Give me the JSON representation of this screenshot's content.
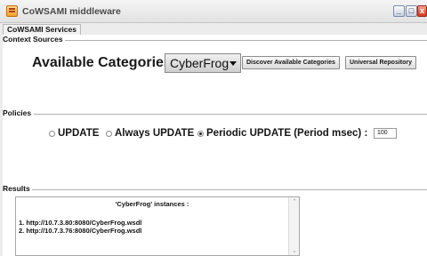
{
  "window": {
    "title": "CoWSAMI middleware"
  },
  "titlebar_buttons": {
    "minimize": "_",
    "maximize": "□",
    "close": "x"
  },
  "tabs": [
    "CoWSAMI Services"
  ],
  "context_sources": {
    "legend": "Context Sources",
    "label": "Available Categories :",
    "category_selected": "CyberFrog",
    "discover_button": "Discover Available Categories",
    "universal_button": "Universal Repository"
  },
  "policies": {
    "legend": "Policies",
    "options": [
      {
        "label": "UPDATE",
        "checked": false
      },
      {
        "label": "Always UPDATE",
        "checked": false
      },
      {
        "label": "Periodic UPDATE (Period msec) :",
        "checked": true
      }
    ],
    "period_value": "100"
  },
  "results": {
    "legend": "Results",
    "heading": "'CyberFrog' instances :",
    "lines": [
      "1. http://10.7.3.80:8080/CyberFrog.wsdl",
      "2. http://10.7.3.76:8080/CyberFrog.wsdl"
    ]
  },
  "scroll_glyphs": {
    "up": "⌃",
    "down": "⌄"
  }
}
